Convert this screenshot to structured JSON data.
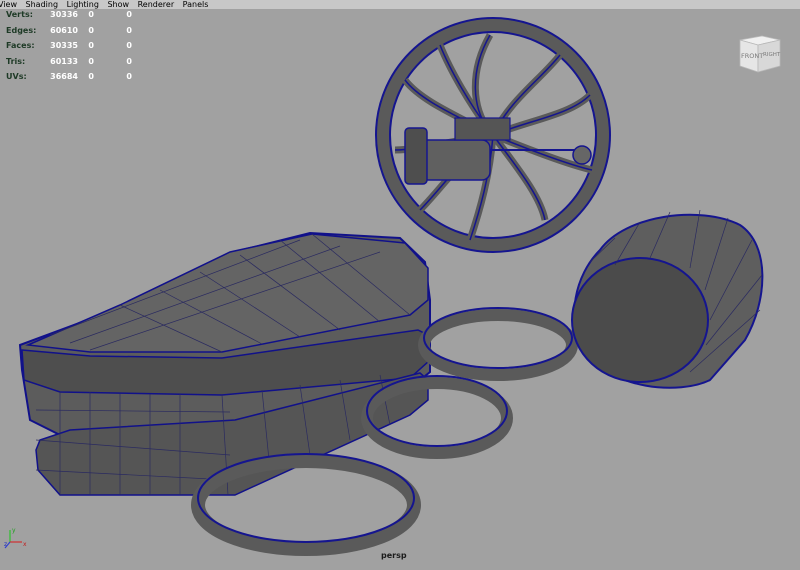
{
  "menu": [
    "View",
    "Shading",
    "Lighting",
    "Show",
    "Renderer",
    "Panels"
  ],
  "stats": [
    {
      "label": "Verts:",
      "values": [
        "30336",
        "0",
        "0"
      ]
    },
    {
      "label": "Edges:",
      "values": [
        "60610",
        "0",
        "0"
      ]
    },
    {
      "label": "Faces:",
      "values": [
        "30335",
        "0",
        "0"
      ]
    },
    {
      "label": "Tris:",
      "values": [
        "60133",
        "0",
        "0"
      ]
    },
    {
      "label": "UVs:",
      "values": [
        "36684",
        "0",
        "0"
      ]
    }
  ],
  "viewcube": {
    "front": "FRONT",
    "right": "RIGHT"
  },
  "camera_label": "persp",
  "axis": {
    "x": "x",
    "y": "y",
    "z": "z"
  },
  "colors": {
    "background": "#a1a1a1",
    "mesh_face": "#5a5a5a",
    "wire": "#1a1a9a",
    "menubar": "#c8c8c8"
  }
}
